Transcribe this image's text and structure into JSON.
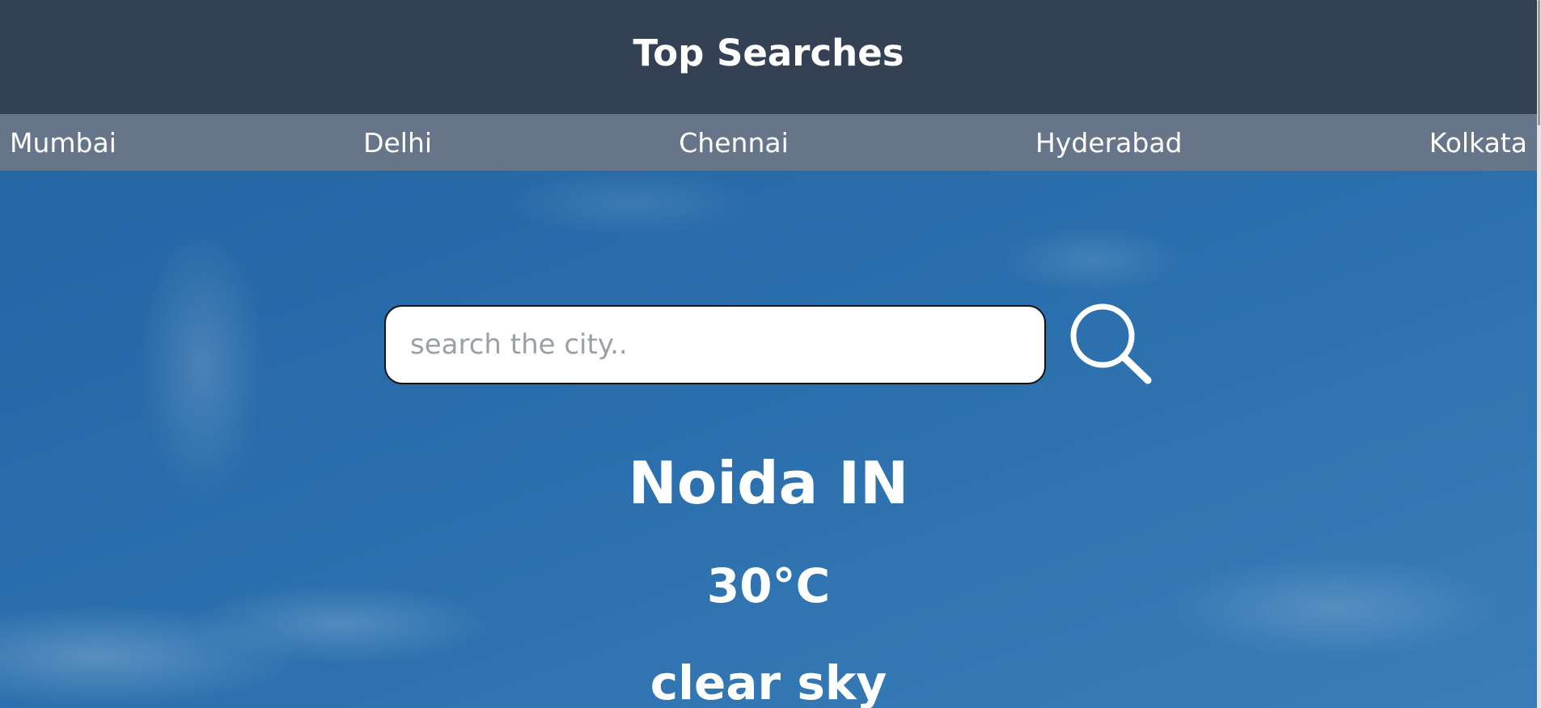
{
  "header": {
    "title": "Top Searches"
  },
  "top_searches": [
    {
      "label": "Mumbai"
    },
    {
      "label": "Delhi"
    },
    {
      "label": "Chennai"
    },
    {
      "label": "Hyderabad"
    },
    {
      "label": "Kolkata"
    }
  ],
  "search": {
    "placeholder": "search the city..",
    "value": "",
    "button_icon": "search-icon"
  },
  "weather": {
    "city": "Noida IN",
    "temperature": "30°C",
    "description": "clear sky"
  },
  "colors": {
    "header_bg": "#344154",
    "nav_bg": "#67758a",
    "sky": "#2a6fad",
    "text": "#ffffff"
  }
}
